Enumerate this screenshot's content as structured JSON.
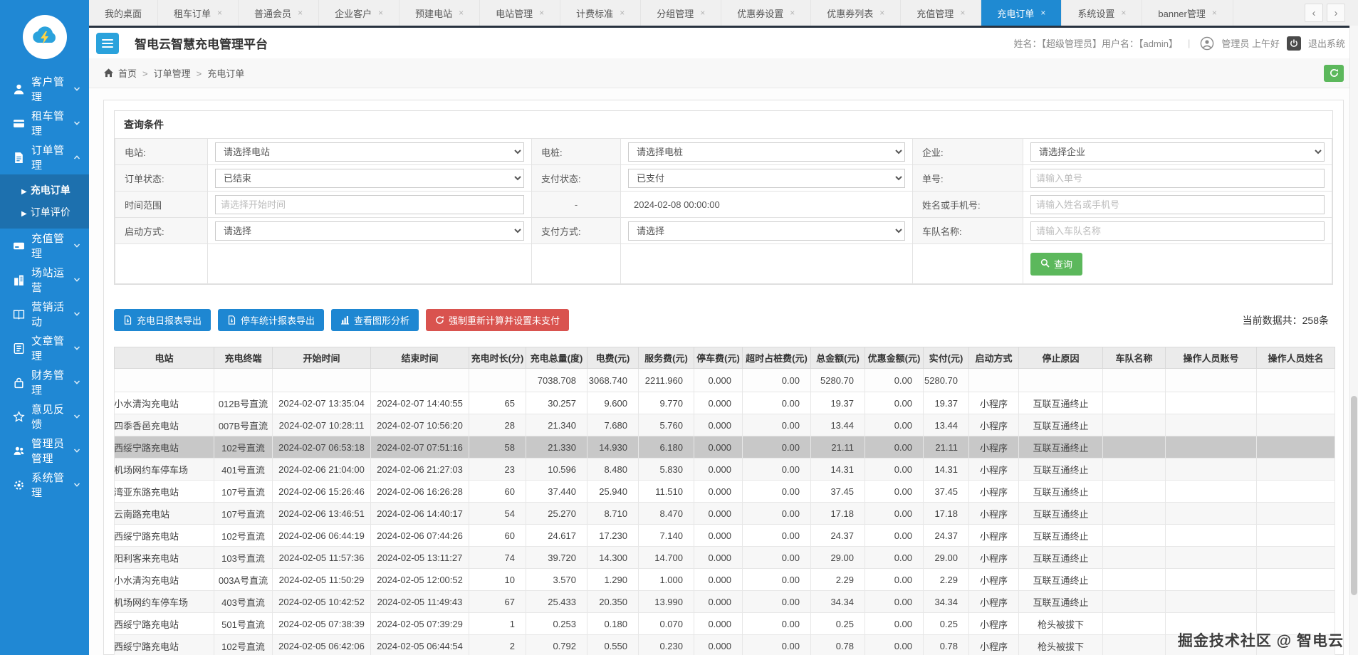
{
  "colors": {
    "primary_blue": "#1f8ad2",
    "sidebar_blue": "#2088d4",
    "submenu_blue": "#1d70ae",
    "success_green": "#5cb85c",
    "danger_red": "#d9534f",
    "dark_bar": "#28323f"
  },
  "tabs": {
    "items": [
      {
        "label": "我的桌面",
        "closable": false,
        "active": false
      },
      {
        "label": "租车订单",
        "closable": true,
        "active": false
      },
      {
        "label": "普通会员",
        "closable": true,
        "active": false
      },
      {
        "label": "企业客户",
        "closable": true,
        "active": false
      },
      {
        "label": "预建电站",
        "closable": true,
        "active": false
      },
      {
        "label": "电站管理",
        "closable": true,
        "active": false
      },
      {
        "label": "计费标准",
        "closable": true,
        "active": false
      },
      {
        "label": "分组管理",
        "closable": true,
        "active": false
      },
      {
        "label": "优惠券设置",
        "closable": true,
        "active": false
      },
      {
        "label": "优惠券列表",
        "closable": true,
        "active": false
      },
      {
        "label": "充值管理",
        "closable": true,
        "active": false
      },
      {
        "label": "充电订单",
        "closable": true,
        "active": true
      },
      {
        "label": "系统设置",
        "closable": true,
        "active": false
      },
      {
        "label": "banner管理",
        "closable": true,
        "active": false
      }
    ],
    "prev_label": "‹",
    "next_label": "›"
  },
  "sidebar": {
    "items": [
      {
        "label": "客户管理",
        "icon": "customer-icon"
      },
      {
        "label": "租车管理",
        "icon": "rentcar-icon"
      },
      {
        "label": "订单管理",
        "icon": "order-icon",
        "expanded": true,
        "children": [
          {
            "label": "充电订单",
            "active": true
          },
          {
            "label": "订单评价",
            "active": false
          }
        ]
      },
      {
        "label": "充值管理",
        "icon": "recharge-icon"
      },
      {
        "label": "场站运营",
        "icon": "station-icon"
      },
      {
        "label": "营销活动",
        "icon": "marketing-icon"
      },
      {
        "label": "文章管理",
        "icon": "article-icon"
      },
      {
        "label": "财务管理",
        "icon": "finance-icon"
      },
      {
        "label": "意见反馈",
        "icon": "feedback-icon"
      },
      {
        "label": "管理员管理",
        "icon": "admin-icon"
      },
      {
        "label": "系统管理",
        "icon": "system-icon"
      }
    ]
  },
  "header": {
    "title": "智电云智慧充电管理平台",
    "user_info": "姓名：【超级管理员】用户名：【admin】",
    "greeting": "管理员 上午好",
    "logout_label": "退出系统"
  },
  "breadcrumb": {
    "items": [
      "首页",
      "订单管理",
      "充电订单"
    ]
  },
  "query": {
    "title": "查询条件",
    "rows": [
      [
        {
          "label": "电站:",
          "type": "select",
          "value": "请选择电站"
        },
        {
          "label": "电桩:",
          "type": "select",
          "value": "请选择电桩"
        },
        {
          "label": "企业:",
          "type": "select",
          "value": "请选择企业"
        }
      ],
      [
        {
          "label": "订单状态:",
          "type": "select",
          "value": "已结束"
        },
        {
          "label": "支付状态:",
          "type": "select",
          "value": "已支付"
        },
        {
          "label": "单号:",
          "type": "input",
          "placeholder": "请输入单号"
        }
      ],
      [
        {
          "label": "时间范围",
          "type": "input",
          "placeholder": "请选择开始时间"
        },
        {
          "label": "-",
          "type": "text",
          "value": "2024-02-08 00:00:00"
        },
        {
          "label": "姓名或手机号:",
          "type": "input",
          "placeholder": "请输入姓名或手机号"
        }
      ],
      [
        {
          "label": "启动方式:",
          "type": "select",
          "value": "请选择"
        },
        {
          "label": "支付方式:",
          "type": "select",
          "value": "请选择"
        },
        {
          "label": "车队名称:",
          "type": "input",
          "placeholder": "请输入车队名称"
        }
      ]
    ],
    "search_label": "查询"
  },
  "actions": {
    "buttons": [
      {
        "label": "充电日报表导出",
        "style": "blue",
        "icon": "export-icon"
      },
      {
        "label": "停车统计报表导出",
        "style": "blue",
        "icon": "export-icon"
      },
      {
        "label": "查看图形分析",
        "style": "blue",
        "icon": "chart-icon"
      },
      {
        "label": "强制重新计算并设置未支付",
        "style": "red",
        "icon": "refresh-icon"
      }
    ],
    "count_text": "当前数据共：258条"
  },
  "table": {
    "headers": [
      "电站",
      "充电终端",
      "开始时间",
      "结束时间",
      "充电时长(分)",
      "充电总量(度)",
      "电费(元)",
      "服务费(元)",
      "停车费(元)",
      "超时占桩费(元)",
      "总金额(元)",
      "优惠金额(元)",
      "实付(元)",
      "启动方式",
      "停止原因",
      "车队名称",
      "操作人员账号",
      "操作人员姓名"
    ],
    "summary": [
      "",
      "",
      "",
      "",
      "",
      "7038.708",
      "3068.740",
      "2211.960",
      "0.000",
      "0.00",
      "5280.70",
      "0.00",
      "5280.70",
      "",
      "",
      "",
      "",
      ""
    ],
    "selected_row": 2,
    "rows": [
      [
        "小水清沟充电站",
        "012B号直流",
        "2024-02-07 13:35:04",
        "2024-02-07 14:40:55",
        "65",
        "30.257",
        "9.600",
        "9.770",
        "0.000",
        "0.00",
        "19.37",
        "0.00",
        "19.37",
        "小程序",
        "互联互通终止",
        "",
        "",
        ""
      ],
      [
        "四季香邑充电站",
        "007B号直流",
        "2024-02-07 10:28:11",
        "2024-02-07 10:56:20",
        "28",
        "21.340",
        "7.680",
        "5.760",
        "0.000",
        "0.00",
        "13.44",
        "0.00",
        "13.44",
        "小程序",
        "互联互通终止",
        "",
        "",
        ""
      ],
      [
        "西绥宁路充电站",
        "102号直流",
        "2024-02-07 06:53:18",
        "2024-02-07 07:51:16",
        "58",
        "21.330",
        "14.930",
        "6.180",
        "0.000",
        "0.00",
        "21.11",
        "0.00",
        "21.11",
        "小程序",
        "互联互通终止",
        "",
        "",
        ""
      ],
      [
        "机场网约车停车场",
        "401号直流",
        "2024-02-06 21:04:00",
        "2024-02-06 21:27:03",
        "23",
        "10.596",
        "8.480",
        "5.830",
        "0.000",
        "0.00",
        "14.31",
        "0.00",
        "14.31",
        "小程序",
        "互联互通终止",
        "",
        "",
        ""
      ],
      [
        "湾亚东路充电站",
        "107号直流",
        "2024-02-06 15:26:46",
        "2024-02-06 16:26:28",
        "60",
        "37.440",
        "25.940",
        "11.510",
        "0.000",
        "0.00",
        "37.45",
        "0.00",
        "37.45",
        "小程序",
        "互联互通终止",
        "",
        "",
        ""
      ],
      [
        "云南路充电站",
        "107号直流",
        "2024-02-06 13:46:51",
        "2024-02-06 14:40:17",
        "54",
        "25.270",
        "8.710",
        "8.470",
        "0.000",
        "0.00",
        "17.18",
        "0.00",
        "17.18",
        "小程序",
        "互联互通终止",
        "",
        "",
        ""
      ],
      [
        "西绥宁路充电站",
        "102号直流",
        "2024-02-06 06:44:19",
        "2024-02-06 07:44:26",
        "60",
        "24.617",
        "17.230",
        "7.140",
        "0.000",
        "0.00",
        "24.37",
        "0.00",
        "24.37",
        "小程序",
        "互联互通终止",
        "",
        "",
        ""
      ],
      [
        "阳利客来充电站",
        "103号直流",
        "2024-02-05 11:57:36",
        "2024-02-05 13:11:27",
        "74",
        "39.720",
        "14.300",
        "14.700",
        "0.000",
        "0.00",
        "29.00",
        "0.00",
        "29.00",
        "小程序",
        "互联互通终止",
        "",
        "",
        ""
      ],
      [
        "小水清沟充电站",
        "003A号直流",
        "2024-02-05 11:50:29",
        "2024-02-05 12:00:52",
        "10",
        "3.570",
        "1.290",
        "1.000",
        "0.000",
        "0.00",
        "2.29",
        "0.00",
        "2.29",
        "小程序",
        "互联互通终止",
        "",
        "",
        ""
      ],
      [
        "机场网约车停车场",
        "403号直流",
        "2024-02-05 10:42:52",
        "2024-02-05 11:49:43",
        "67",
        "25.433",
        "20.350",
        "13.990",
        "0.000",
        "0.00",
        "34.34",
        "0.00",
        "34.34",
        "小程序",
        "互联互通终止",
        "",
        "",
        ""
      ],
      [
        "西绥宁路充电站",
        "501号直流",
        "2024-02-05 07:38:39",
        "2024-02-05 07:39:29",
        "1",
        "0.253",
        "0.180",
        "0.070",
        "0.000",
        "0.00",
        "0.25",
        "0.00",
        "0.25",
        "小程序",
        "枪头被拔下",
        "",
        "",
        ""
      ],
      [
        "西绥宁路充电站",
        "102号直流",
        "2024-02-05 06:42:06",
        "2024-02-05 06:44:54",
        "2",
        "0.792",
        "0.550",
        "0.230",
        "0.000",
        "0.00",
        "0.78",
        "0.00",
        "0.78",
        "小程序",
        "枪头被拔下",
        "",
        "",
        ""
      ]
    ]
  },
  "watermark": "掘金技术社区 @ 智电云"
}
